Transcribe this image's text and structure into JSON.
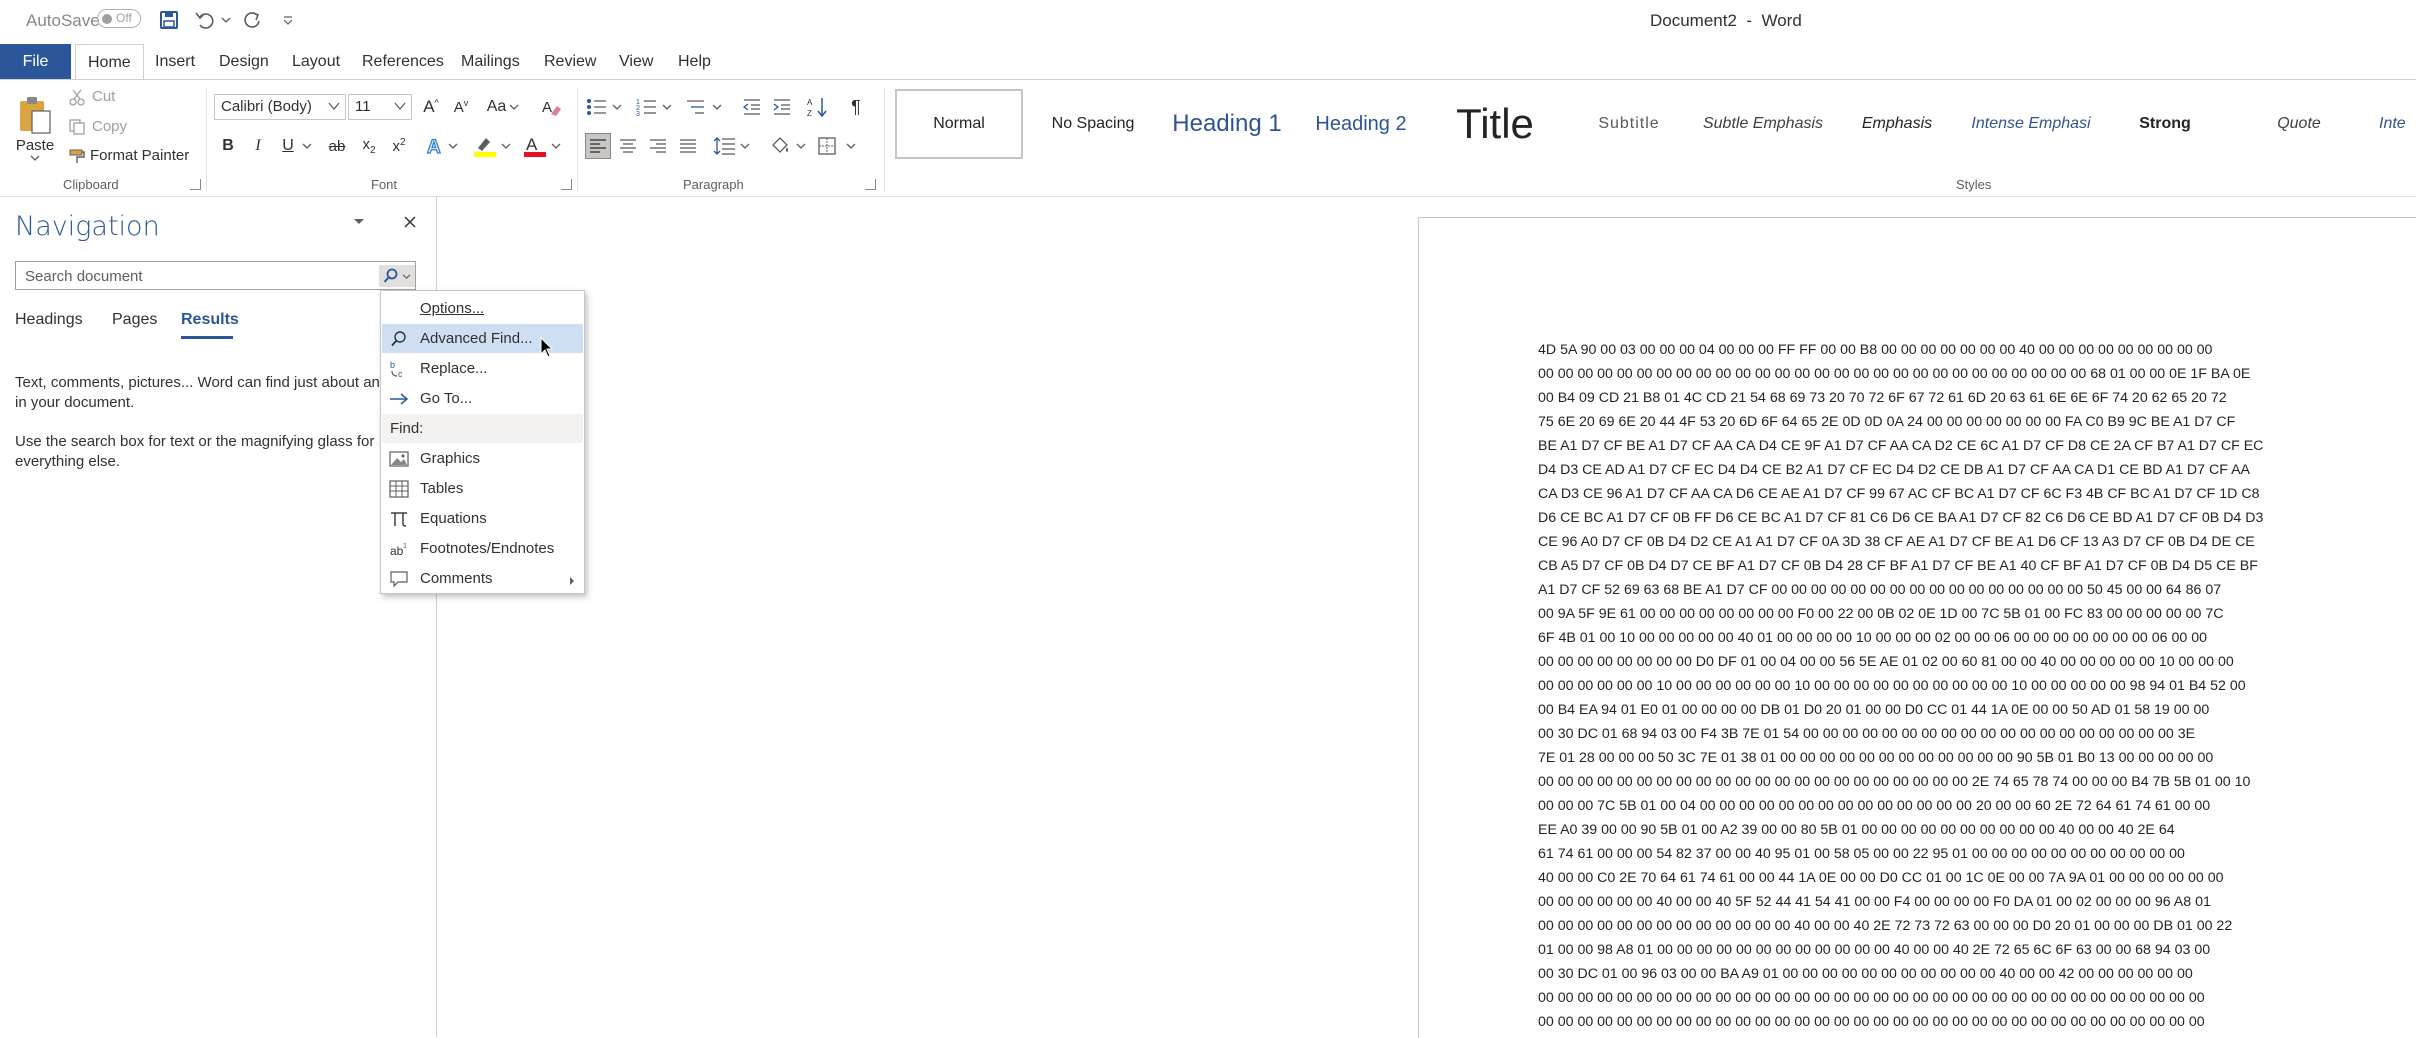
{
  "titlebar": {
    "autosave_label": "AutoSave",
    "autosave_state": "Off",
    "doc_title": "Document2  -  Word"
  },
  "tabs": [
    "File",
    "Home",
    "Insert",
    "Design",
    "Layout",
    "References",
    "Mailings",
    "Review",
    "View",
    "Help"
  ],
  "clipboard": {
    "paste": "Paste",
    "cut": "Cut",
    "copy": "Copy",
    "format_painter": "Format Painter",
    "group_label": "Clipboard"
  },
  "font": {
    "name": "Calibri (Body)",
    "size": "11",
    "group_label": "Font",
    "bold": "B",
    "italic": "I",
    "underline": "U",
    "strike": "ab",
    "change_case": "Aa"
  },
  "paragraph": {
    "group_label": "Paragraph"
  },
  "styles": {
    "group_label": "Styles",
    "items": [
      "Normal",
      "No Spacing",
      "Heading 1",
      "Heading 2",
      "Title",
      "Subtitle",
      "Subtle Emphasis",
      "Emphasis",
      "Intense Emphasi",
      "Strong",
      "Quote",
      "Inte"
    ]
  },
  "navigation": {
    "title": "Navigation",
    "search_placeholder": "Search document",
    "tabs": [
      "Headings",
      "Pages",
      "Results"
    ],
    "text1_line1": "Text, comments, pictures... Word can find just about any",
    "text1_line2": "in your document.",
    "text2_line1": "Use the search box for text or the magnifying glass for",
    "text2_line2": "everything else."
  },
  "menu": {
    "options": "Options...",
    "advanced_find": "Advanced Find...",
    "replace": "Replace...",
    "go_to": "Go To...",
    "find_header": "Find:",
    "graphics": "Graphics",
    "tables": "Tables",
    "equations": "Equations",
    "footnotes": "Footnotes/Endnotes",
    "comments": "Comments"
  },
  "document": {
    "lines": [
      "4D 5A 90 00 03 00 00 00 04 00 00 00 FF FF 00 00 B8 00 00 00 00 00 00 00 40 00 00 00 00 00 00 00 00 00",
      "00 00 00 00 00 00 00 00 00 00 00 00 00 00 00 00 00 00 00 00 00 00 00 00 00 00 00 00 68 01 00 00 0E 1F BA 0E",
      "00 B4 09 CD 21 B8 01 4C CD 21 54 68 69 73 20 70 72 6F 67 72 61 6D 20 63 61 6E 6E 6F 74 20 62 65 20 72",
      "75 6E 20 69 6E 20 44 4F 53 20 6D 6F 64 65 2E 0D 0D 0A 24 00 00 00 00 00 00 00 FA C0 B9 9C BE A1 D7 CF",
      "BE A1 D7 CF BE A1 D7 CF AA CA D4 CE 9F A1 D7 CF AA CA D2 CE 6C A1 D7 CF D8 CE 2A CF B7 A1 D7 CF EC",
      "D4 D3 CE AD A1 D7 CF EC D4 D4 CE B2 A1 D7 CF EC D4 D2 CE DB A1 D7 CF AA CA D1 CE BD A1 D7 CF AA",
      "CA D3 CE 96 A1 D7 CF AA CA D6 CE AE A1 D7 CF 99 67 AC CF BC A1 D7 CF 6C F3 4B CF BC A1 D7 CF 1D C8",
      "D6 CE BC A1 D7 CF 0B FF D6 CE BC A1 D7 CF 81 C6 D6 CE BA A1 D7 CF 82 C6 D6 CE BD A1 D7 CF 0B D4 D3",
      "CE 96 A0 D7 CF 0B D4 D2 CE A1 A1 D7 CF 0A 3D 38 CF AE A1 D7 CF BE A1 D6 CF 13 A3 D7 CF 0B D4 DE CE",
      "CB A5 D7 CF 0B D4 D7 CE BF A1 D7 CF 0B D4 28 CF BF A1 D7 CF BE A1 40 CF BF A1 D7 CF 0B D4 D5 CE BF",
      "A1 D7 CF 52 69 63 68 BE A1 D7 CF 00 00 00 00 00 00 00 00 00 00 00 00 00 00 00 00 50 45 00 00 64 86 07",
      "00 9A 5F 9E 61 00 00 00 00 00 00 00 00 F0 00 22 00 0B 02 0E 1D 00 7C 5B 01 00 FC 83 00 00 00 00 00 7C",
      "6F 4B 01 00 10 00 00 00 00 00 40 01 00 00 00 00 10 00 00 00 02 00 00 06 00 00 00 00 00 00 00 06 00 00",
      "00 00 00 00 00 00 00 00 D0 DF 01 00 04 00 00 56 5E AE 01 02 00 60 81 00 00 40 00 00 00 00 00 10 00 00 00",
      "00 00 00 00 00 00 10 00 00 00 00 00 00 10 00 00 00 00 00 00 00 00 00 00 10 00 00 00 00 00 98 94 01 B4 52 00",
      "00 B4 EA 94 01 E0 01 00 00 00 00 DB 01 D0 20 01 00 00 D0 CC 01 44 1A 0E 00 00 50 AD 01 58 19 00 00",
      "00 30 DC 01 68 94 03 00 F4 3B 7E 01 54 00 00 00 00 00 00 00 00 00 00 00 00 00 00 00 00 00 00 00 3E",
      "7E 01 28 00 00 00 50 3C 7E 01 38 01 00 00 00 00 00 00 00 00 00 00 00 00 90 5B 01 B0 13 00 00 00 00 00",
      "00 00 00 00 00 00 00 00 00 00 00 00 00 00 00 00 00 00 00 00 00 00 2E 74 65 78 74 00 00 00 B4 7B 5B 01 00 10",
      "00 00 00 7C 5B 01 00 04 00 00 00 00 00 00 00 00 00 00 00 00 00 00 20 00 00 60 2E 72 64 61 74 61 00 00",
      "EE A0 39 00 00 90 5B 01 00 A2 39 00 00 80 5B 01 00 00 00 00 00 00 00 00 00 00 40 00 00 40 2E 64",
      "61 74 61 00 00 00 54 82 37 00 00 40 95 01 00 58 05 00 00 22 95 01 00 00 00 00 00 00 00 00 00 00 00",
      "40 00 00 C0 2E 70 64 61 74 61 00 00 44 1A 0E 00 00 D0 CC 01 00 1C 0E 00 00 7A 9A 01 00 00 00 00 00 00",
      "00 00 00 00 00 00 40 00 00 40 5F 52 44 41 54 41 00 00 F4 00 00 00 00 F0 DA 01 00 02 00 00 00 96 A8 01",
      "00 00 00 00 00 00 00 00 00 00 00 00 00 40 00 00 40 2E 72 73 72 63 00 00 00 D0 20 01 00 00 00 DB 01 00 22",
      "01 00 00 98 A8 01 00 00 00 00 00 00 00 00 00 00 00 00 40 00 00 40 2E 72 65 6C 6F 63 00 00 68 94 03 00",
      "00 30 DC 01 00 96 03 00 00 BA A9 01 00 00 00 00 00 00 00 00 00 00 00 40 00 00 42 00 00 00 00 00 00",
      "00 00 00 00 00 00 00 00 00 00 00 00 00 00 00 00 00 00 00 00 00 00 00 00 00 00 00 00 00 00 00 00 00 00",
      "00 00 00 00 00 00 00 00 00 00 00 00 00 00 00 00 00 00 00 00 00 00 00 00 00 00 00 00 00 00 00 00 00 00"
    ]
  }
}
